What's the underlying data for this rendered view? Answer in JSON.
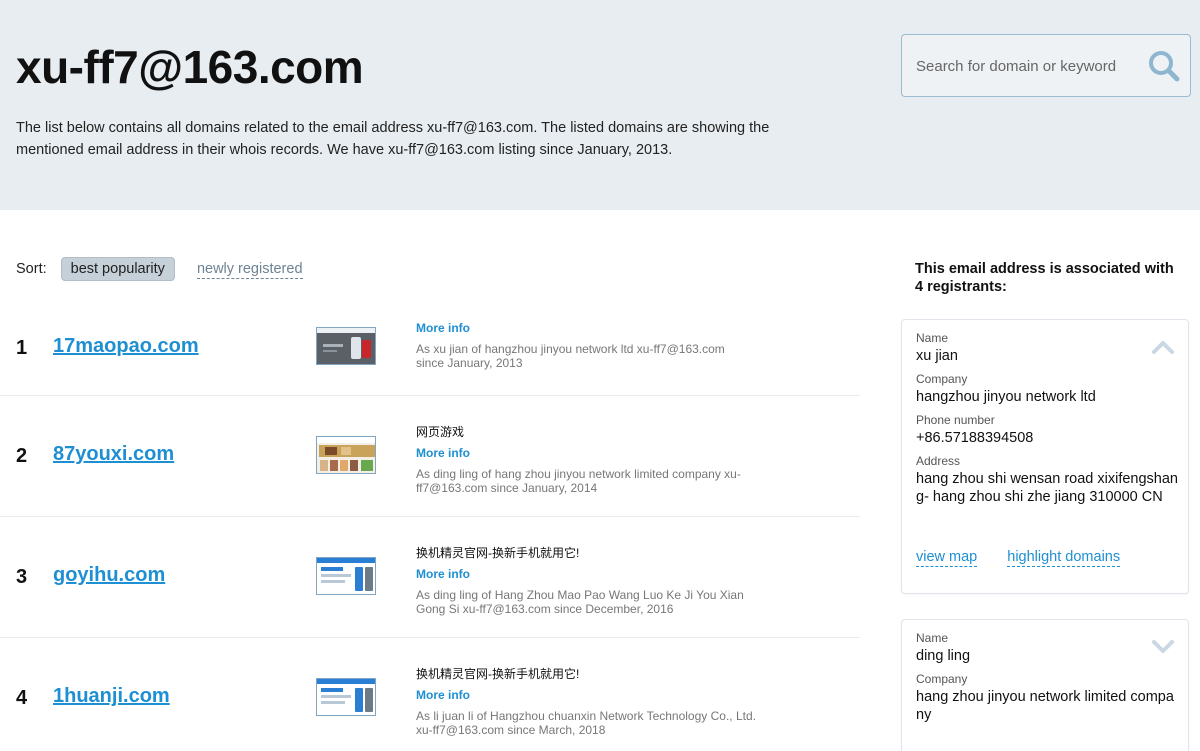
{
  "header": {
    "title": "xu-ff7@163.com",
    "description": "The list below contains all domains related to the email address xu-ff7@163.com. The listed domains are showing the mentioned email address in their whois records. We have xu-ff7@163.com listing since January, 2013."
  },
  "search": {
    "placeholder": "Search for domain or keyword",
    "icon": "search-icon"
  },
  "sort": {
    "label": "Sort:",
    "active": "best popularity",
    "alternate": "newly registered"
  },
  "domains": [
    {
      "rank": "1",
      "domain": "17maopao.com",
      "title": "",
      "more": "More info",
      "desc": "As xu jian of hangzhou jinyou network ltd xu-ff7@163.com since January, 2013"
    },
    {
      "rank": "2",
      "domain": "87youxi.com",
      "title": "网页游戏",
      "more": "More info",
      "desc": "As ding ling of hang zhou jinyou network limited company xu-ff7@163.com since January, 2014"
    },
    {
      "rank": "3",
      "domain": "goyihu.com",
      "title": "换机精灵官网-换新手机就用它!",
      "more": "More info",
      "desc": "As ding ling of Hang Zhou Mao Pao Wang Luo Ke Ji You Xian Gong Si xu-ff7@163.com since December, 2016"
    },
    {
      "rank": "4",
      "domain": "1huanji.com",
      "title": "换机精灵官网-换新手机就用它!",
      "more": "More info",
      "desc": "As li juan li of Hangzhou chuanxin Network Technology Co., Ltd. xu-ff7@163.com since March, 2018"
    }
  ],
  "sidebar": {
    "heading": "This email address is associated with 4 registrants:",
    "registrants": [
      {
        "name_label": "Name",
        "name": "xu jian",
        "company_label": "Company",
        "company": "hangzhou jinyou network ltd",
        "phone_label": "Phone number",
        "phone": "+86.57188394508",
        "address_label": "Address",
        "address": "hang zhou shi wensan road xixifengshang- hang zhou shi zhe jiang 310000 CN",
        "view_map": "view map",
        "highlight": "highlight domains",
        "expanded": true
      },
      {
        "name_label": "Name",
        "name": "ding ling",
        "company_label": "Company",
        "company": "hang zhou jinyou network limited company",
        "expanded": false
      }
    ]
  },
  "colors": {
    "accent": "#1e8fd3",
    "hero_bg": "#e8edf1",
    "chevron": "#c9d8e4"
  }
}
